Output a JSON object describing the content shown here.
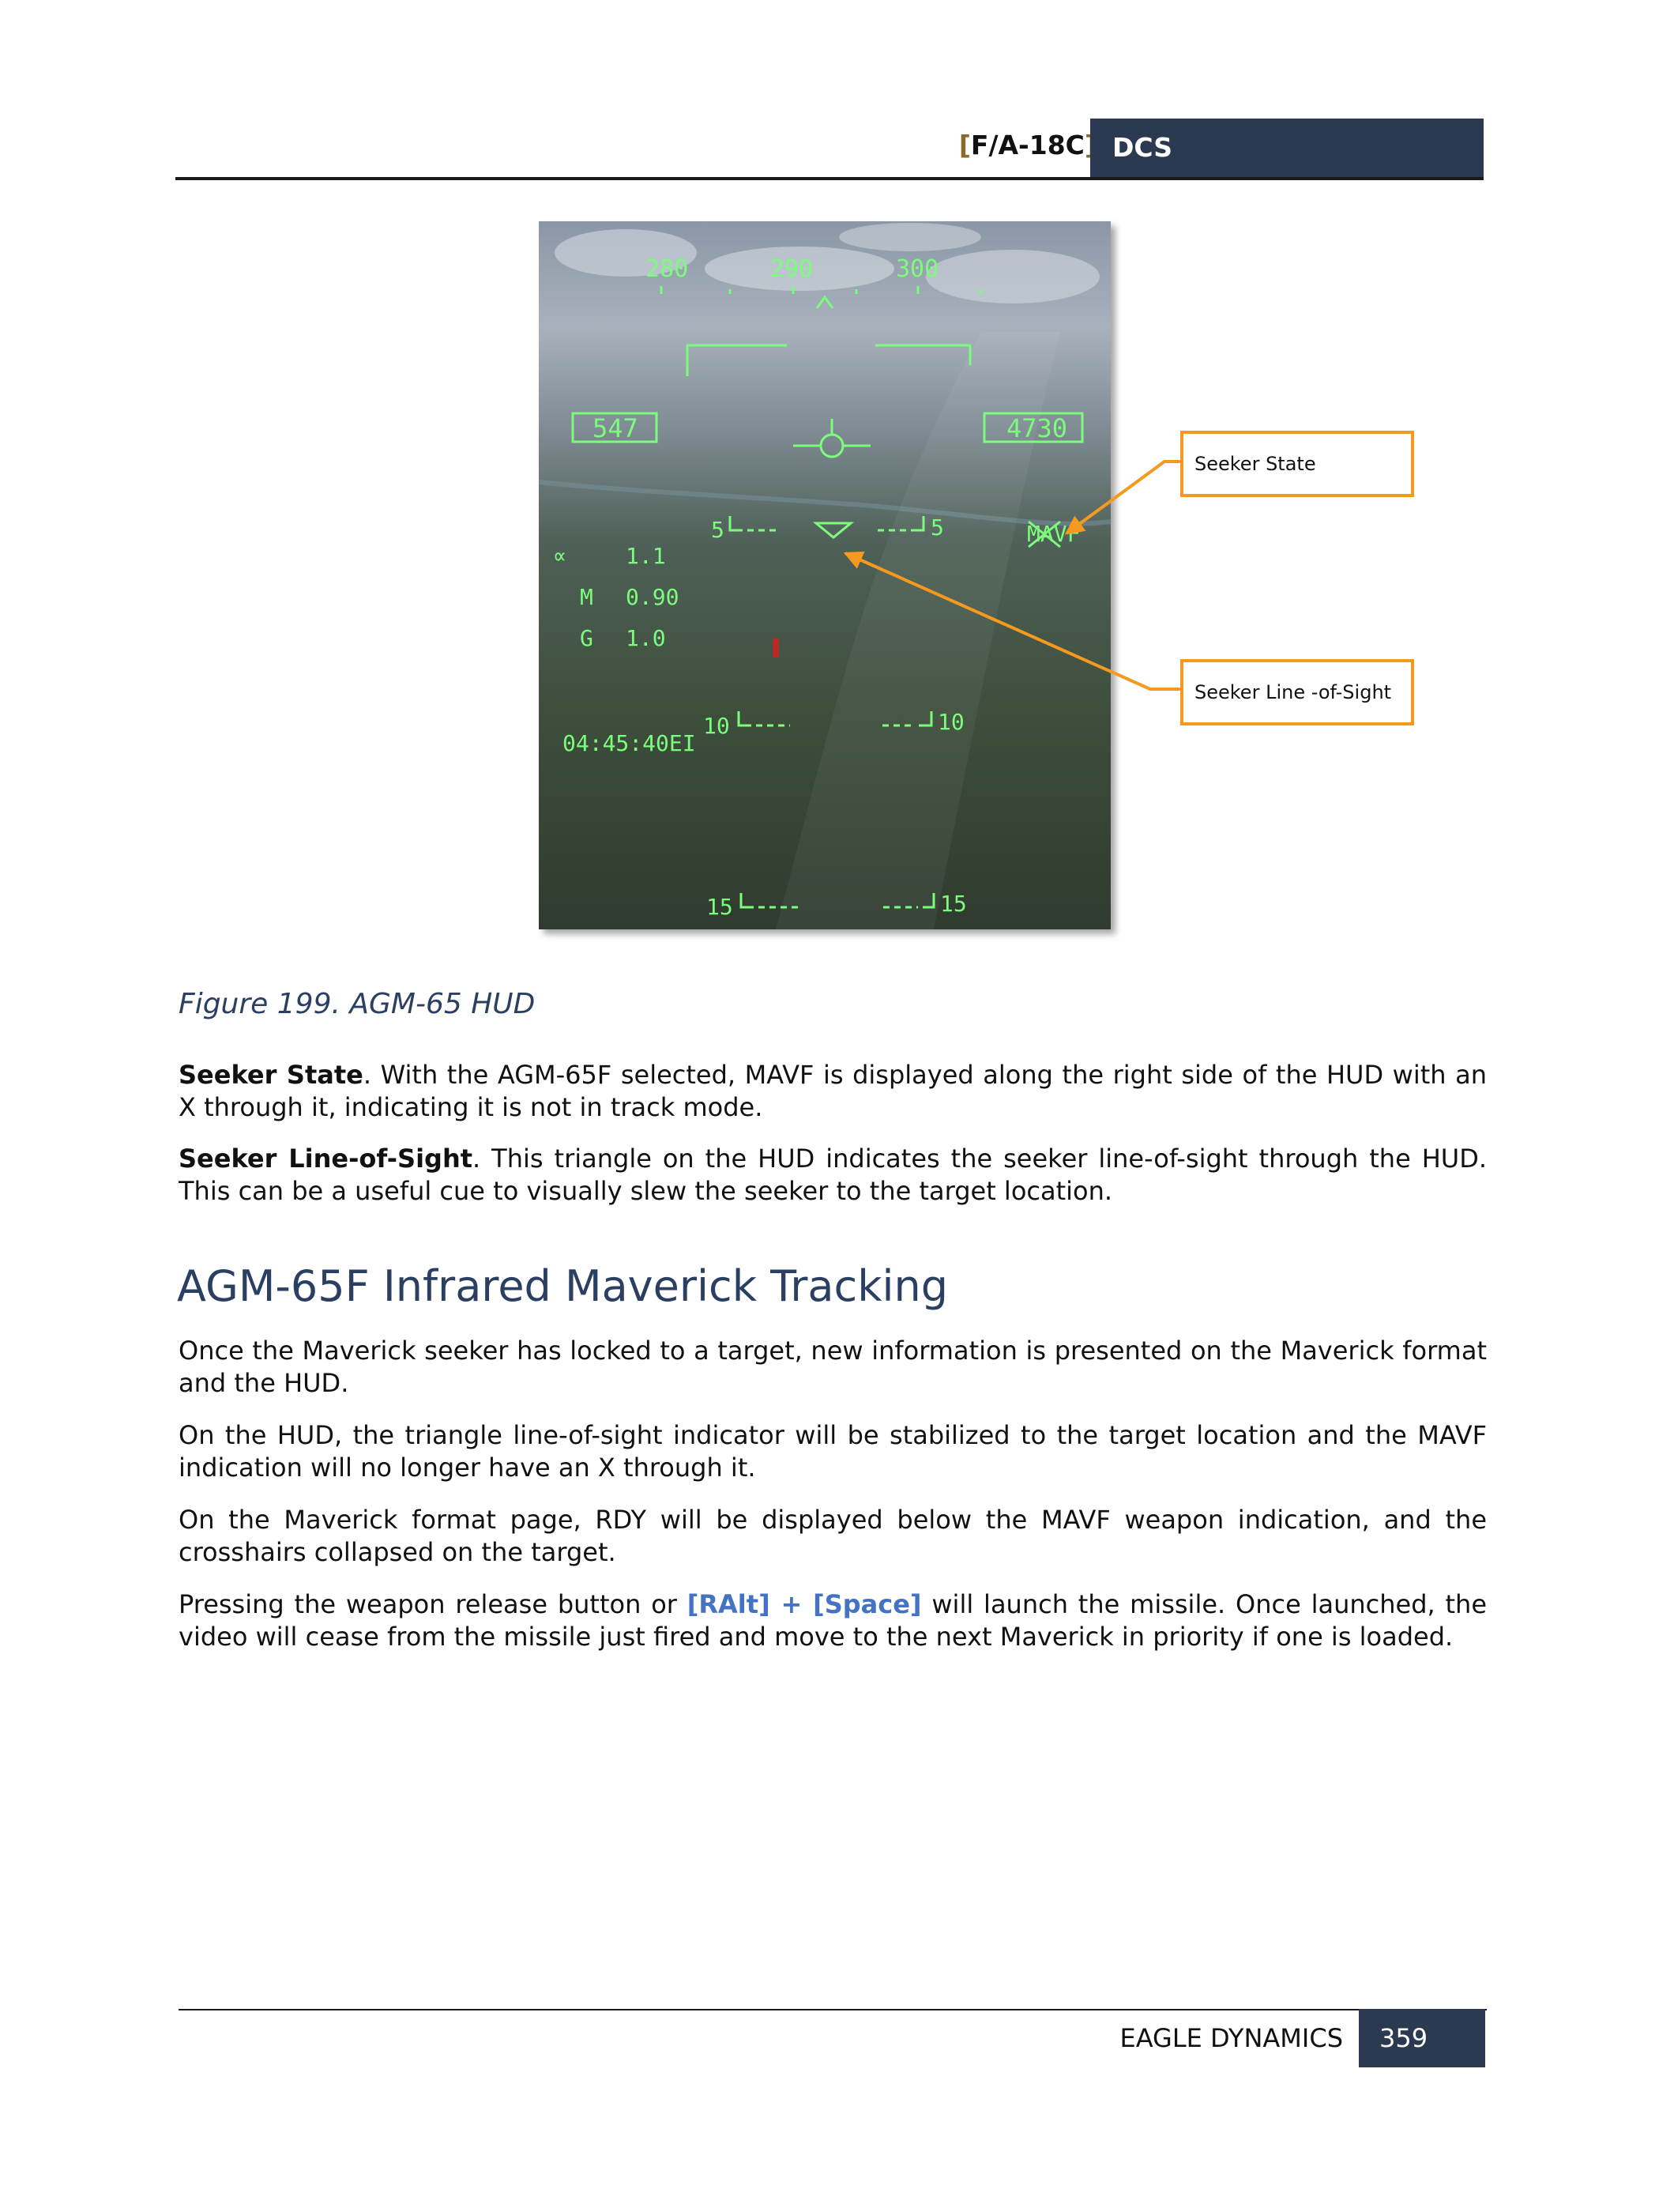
{
  "header": {
    "aircraft_open": "[",
    "aircraft_name": "F/A-18C",
    "aircraft_close": "]",
    "brand": "DCS"
  },
  "figure": {
    "hud": {
      "heading_ticks": [
        "280",
        "290",
        "300"
      ],
      "airspeed": "547",
      "altitude": "4730",
      "aoa_symbol": "∝",
      "aoa_value": "1.1",
      "mach_label": "M",
      "mach_value": "0.90",
      "g_label": "G",
      "g_value": "1.0",
      "clock": "04:45:40EI",
      "weapon": "MAVF",
      "pitch_ladder": [
        {
          "left": "5",
          "right": "5"
        },
        {
          "left": "10",
          "right": "10"
        },
        {
          "left": "15",
          "right": "15"
        }
      ]
    },
    "callouts": [
      "Seeker State",
      "Seeker Line -of-Sight"
    ],
    "caption": "Figure 199. AGM-65 HUD"
  },
  "paragraphs": {
    "seeker_state": {
      "term": "Seeker State",
      "text": ". With the AGM-65F selected, MAVF is displayed along the right side of the HUD with an X through it, indicating it is not in track mode."
    },
    "seeker_los": {
      "term": "Seeker Line-of-Sight",
      "text": ". This triangle on the HUD indicates the seeker line-of-sight through the HUD. This can be a useful cue to visually slew the seeker to the target location."
    }
  },
  "section": {
    "title": "AGM-65F Infrared Maverick Tracking",
    "p1": "Once the Maverick seeker has locked to a target, new information is presented on the Maverick format and the HUD.",
    "p2": "On the HUD, the triangle line-of-sight indicator will be stabilized to the target location and the MAVF indication will no longer have an X through it.",
    "p3": "On the Maverick format page, RDY will be displayed below the MAVF weapon indication, and the crosshairs collapsed on the target.",
    "p4_before": "Pressing the weapon release button or ",
    "p4_key": "[RAlt] + [Space]",
    "p4_after": " will launch the missile. Once launched, the video will cease from the missile just fired and move to the next Maverick in priority if one is loaded."
  },
  "footer": {
    "company": "EAGLE DYNAMICS",
    "page": "359"
  },
  "colors": {
    "hud_symbology": "#7CFC7C",
    "callout": "#f59a1e",
    "header_bar": "#2b3a50",
    "heading_blue": "#2b3f63",
    "key_blue": "#4472c4"
  }
}
